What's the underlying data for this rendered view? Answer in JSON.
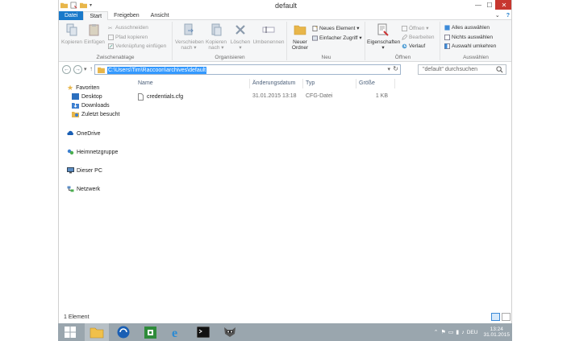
{
  "window": {
    "title": "default"
  },
  "ribbon_tabs": [
    "Datei",
    "Start",
    "Freigeben",
    "Ansicht"
  ],
  "ribbon": {
    "clipboard": {
      "label": "Zwischenablage",
      "copy": "Kopieren",
      "paste": "Einfügen",
      "cut": "Ausschneiden",
      "copy_path": "Pfad kopieren",
      "paste_shortcut": "Verknüpfung einfügen"
    },
    "organize": {
      "label": "Organisieren",
      "move_to_l1": "Verschieben",
      "move_to_l2": "nach ▾",
      "copy_to_l1": "Kopieren",
      "copy_to_l2": "nach ▾",
      "delete_l1": "Löschen",
      "delete_l2": "▾",
      "rename": "Umbenennen"
    },
    "new": {
      "label": "Neu",
      "new_folder_l1": "Neuer",
      "new_folder_l2": "Ordner",
      "new_item": "Neues Element ▾",
      "easy_access": "Einfacher Zugriff ▾"
    },
    "open": {
      "label": "Öffnen",
      "properties_l1": "Eigenschaften",
      "properties_l2": "▾",
      "open": "Öffnen ▾",
      "edit": "Bearbeiten",
      "history": "Verlauf"
    },
    "select": {
      "label": "Auswählen",
      "select_all": "Alles auswählen",
      "select_none": "Nichts auswählen",
      "invert": "Auswahl umkehren"
    }
  },
  "address": {
    "path": "C:\\Users\\Tim\\Raccoon\\archives\\default",
    "search_placeholder": "\"default\" durchsuchen"
  },
  "nav_pane": {
    "favorites": "Favoriten",
    "desktop": "Desktop",
    "downloads": "Downloads",
    "recent": "Zuletzt besucht",
    "onedrive": "OneDrive",
    "homegroup": "Heimnetzgruppe",
    "this_pc": "Dieser PC",
    "network": "Netzwerk"
  },
  "columns": {
    "name": "Name",
    "date": "Änderungsdatum",
    "type": "Typ",
    "size": "Größe"
  },
  "files": [
    {
      "name": "credentials.cfg",
      "date": "31.01.2015 13:18",
      "type": "CFG-Datei",
      "size": "1 KB"
    }
  ],
  "status": {
    "count": "1 Element"
  },
  "taskbar": {
    "lang": "DEU",
    "time": "13:24",
    "date": "31.01.2015"
  },
  "colors": {
    "file_tab": "#1979ca",
    "selection": "#3399ff",
    "close_button": "#c7372f",
    "taskbar": "#9aa6ae"
  }
}
